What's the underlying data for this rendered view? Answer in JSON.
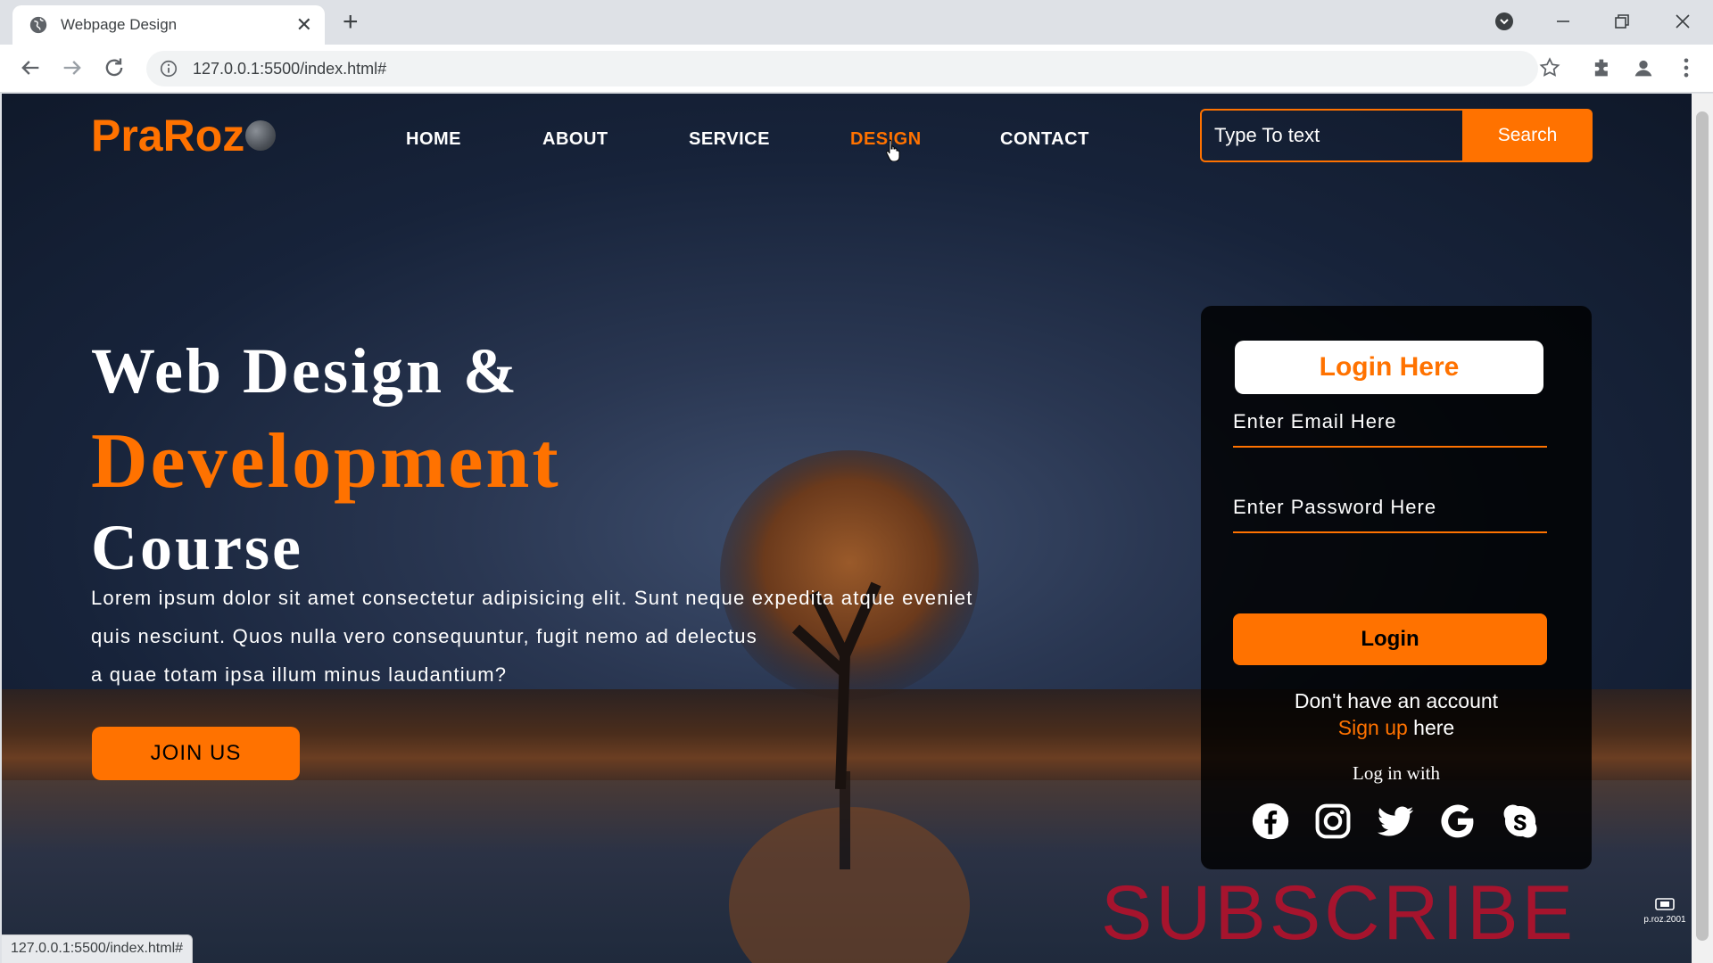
{
  "browser": {
    "tab_title": "Webpage Design",
    "tab_close": "✕",
    "new_tab": "+",
    "url": "127.0.0.1:5500/index.html#",
    "status_url": "127.0.0.1:5500/index.html#"
  },
  "header": {
    "logo": "PraRoz",
    "nav": [
      "HOME",
      "ABOUT",
      "SERVICE",
      "DESIGN",
      "CONTACT"
    ],
    "active_nav": "DESIGN",
    "search_placeholder": "Type To text",
    "search_button": "Search"
  },
  "hero": {
    "line1": "Web Design &",
    "line2": "Development",
    "line3": "Course",
    "paragraph": [
      "Lorem ipsum dolor sit amet consectetur adipisicing elit. Sunt neque expedita atque eveniet",
      "quis nesciunt. Quos nulla vero consequuntur, fugit nemo ad delectus",
      "a quae totam ipsa illum minus laudantium?"
    ],
    "join_button": "JOIN US"
  },
  "login": {
    "title": "Login Here",
    "email_placeholder": "Enter Email Here",
    "password_placeholder": "Enter Password Here",
    "login_button": "Login",
    "no_account": "Don't have an account",
    "signup_link": "Sign up",
    "signup_suffix": " here",
    "login_with": "Log in with",
    "social_icons": [
      "facebook-icon",
      "instagram-icon",
      "twitter-icon",
      "google-icon",
      "skype-icon"
    ]
  },
  "overlay": {
    "subscribe": "SUBSCRIBE",
    "watermark": "p.roz.2001"
  },
  "colors": {
    "accent": "#ff7200",
    "subscribe_red": "#b5122c"
  }
}
